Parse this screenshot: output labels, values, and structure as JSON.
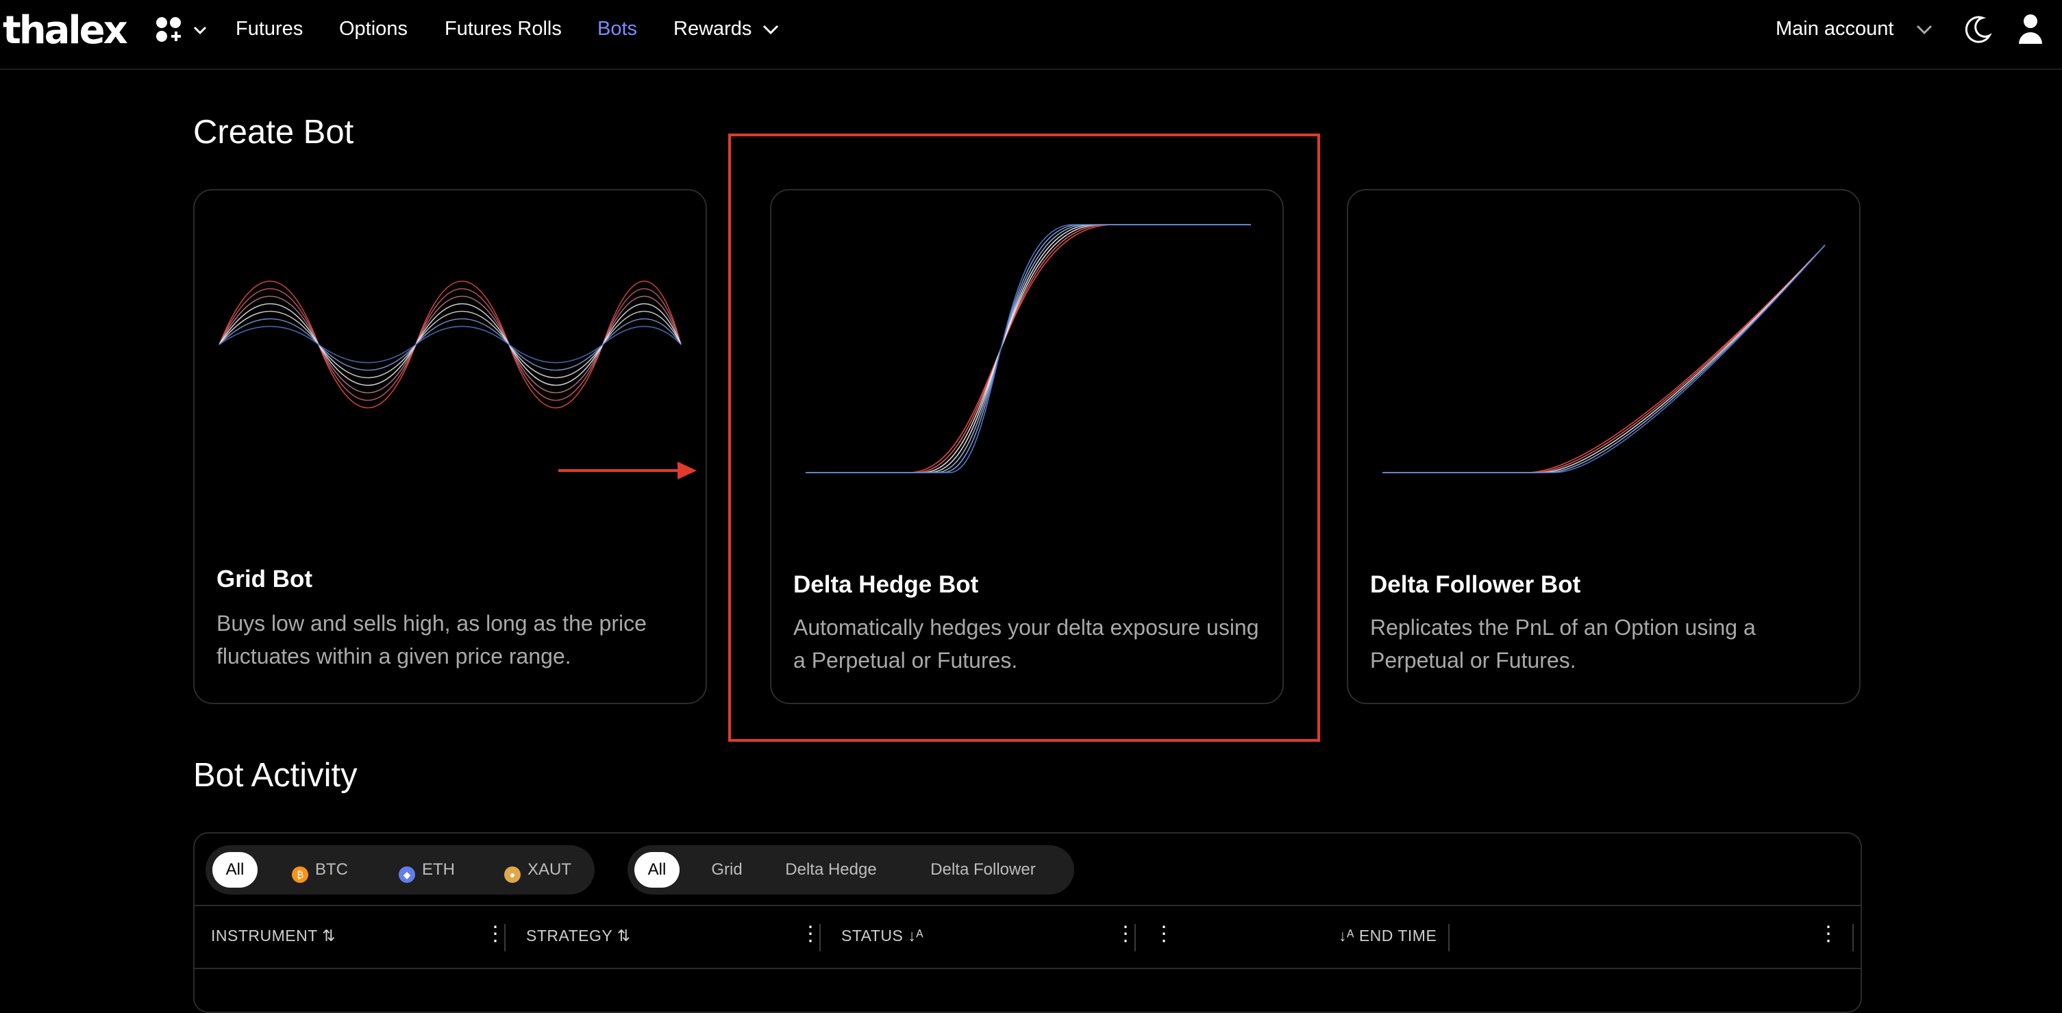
{
  "nav": {
    "logo": "thalex",
    "items": [
      "Futures",
      "Options",
      "Futures Rolls",
      "Bots",
      "Rewards"
    ],
    "active": "Bots",
    "account": "Main account"
  },
  "create_bot": {
    "heading": "Create Bot",
    "cards": [
      {
        "title": "Grid Bot",
        "description": "Buys low and sells high, as long as the price fluctuates within a given price range."
      },
      {
        "title": "Delta Hedge Bot",
        "description": "Automatically hedges your delta exposure using a Perpetual or Futures."
      },
      {
        "title": "Delta Follower Bot",
        "description": "Replicates the PnL of an Option using a Perpetual or Futures."
      }
    ]
  },
  "activity": {
    "heading": "Bot Activity",
    "asset_filters": [
      "All",
      "BTC",
      "ETH",
      "XAUT"
    ],
    "strategy_filters": [
      "All",
      "Grid",
      "Delta Hedge",
      "Delta Follower"
    ],
    "columns": [
      "INSTRUMENT",
      "STRATEGY",
      "STATUS",
      "END TIME"
    ]
  },
  "colors": {
    "accent": "#7b8cff",
    "highlight": "#e03b2b",
    "btc": "#f7931a",
    "eth": "#627eea",
    "xaut": "#e0a84a"
  }
}
